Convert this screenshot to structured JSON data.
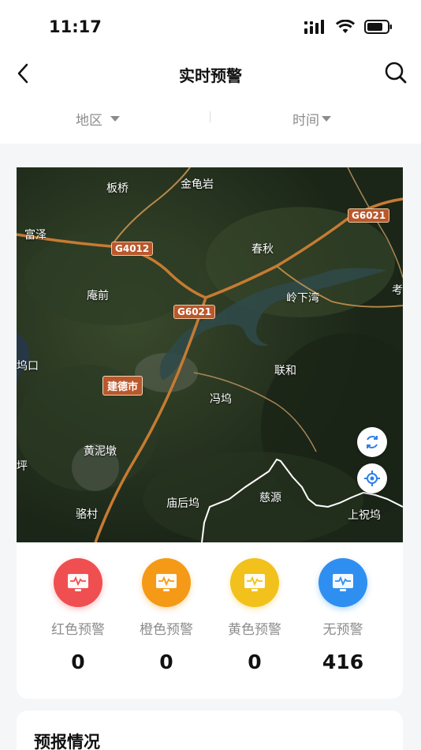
{
  "status_bar": {
    "time": "11:17"
  },
  "nav": {
    "title": "实时预警"
  },
  "filters": {
    "region": "地区",
    "time": "时间"
  },
  "map": {
    "places": [
      "板桥",
      "金龟岩",
      "富泽",
      "春秋",
      "庵前",
      "岭下湾",
      "坞口",
      "联和",
      "冯坞",
      "黄泥墩",
      "坪",
      "庙后坞",
      "慈源",
      "骆村",
      "上祝坞",
      "考"
    ],
    "roads": [
      "G6021",
      "G4012",
      "G6021"
    ],
    "city": "建德市"
  },
  "stats": [
    {
      "label": "红色预警",
      "value": "0",
      "color": "#ef4f50"
    },
    {
      "label": "橙色预警",
      "value": "0",
      "color": "#f59a16"
    },
    {
      "label": "黄色预警",
      "value": "0",
      "color": "#f2c11b"
    },
    {
      "label": "无预警",
      "value": "416",
      "color": "#2f8ff0"
    }
  ],
  "forecast": {
    "title": "预报情况"
  }
}
